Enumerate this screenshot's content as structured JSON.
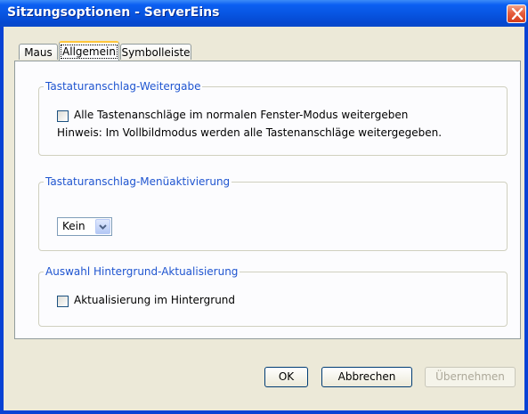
{
  "window": {
    "title": "Sitzungsoptionen - ServerEins"
  },
  "tabs": [
    {
      "label": "Maus"
    },
    {
      "label": "Allgemein"
    },
    {
      "label": "Symbolleiste"
    }
  ],
  "active_tab": "Allgemein",
  "groups": {
    "keystroke_forwarding": {
      "title": "Tastaturanschlag-Weitergabe",
      "checkbox_label": "Alle Tastenanschläge im normalen Fenster-Modus weitergeben",
      "checked": false,
      "hint": "Hinweis: Im Vollbildmodus werden alle Tastenanschläge weitergegeben."
    },
    "menu_activation": {
      "title": "Tastaturanschlag-Menüaktivierung",
      "selected": "Kein"
    },
    "background_refresh": {
      "title": "Auswahl Hintergrund-Aktualisierung",
      "checkbox_label": "Aktualisierung im Hintergrund",
      "checked": false
    }
  },
  "buttons": {
    "ok": "OK",
    "cancel": "Abbrechen",
    "apply": "Übernehmen"
  },
  "colors": {
    "title_bar": "#0754e0",
    "group_title": "#1f55d0",
    "dialog_face": "#ece9d8",
    "close_button": "#d43d1c"
  }
}
